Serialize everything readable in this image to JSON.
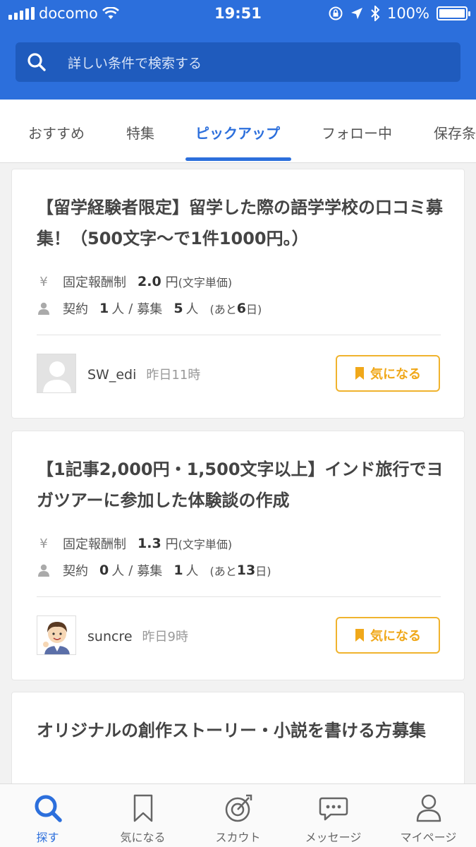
{
  "status_bar": {
    "carrier": "docomo",
    "time": "19:51",
    "battery": "100%"
  },
  "search": {
    "placeholder": "詳しい条件で検索する"
  },
  "tabs": [
    {
      "label": "おすすめ"
    },
    {
      "label": "特集"
    },
    {
      "label": "ピックアップ",
      "active": true
    },
    {
      "label": "フォロー中"
    },
    {
      "label": "保存条"
    }
  ],
  "cards": [
    {
      "title": "【留学経験者限定】留学した際の語学学校の口コミ募集！（500文字〜で1件1000円。）",
      "currency_icon": "¥",
      "pay_type": "固定報酬制",
      "price": "2.0",
      "price_unit": "円",
      "price_note": "(文字単価)",
      "contract_label": "契約",
      "contract_count": "1",
      "person_unit": "人",
      "separator": "/",
      "recruit_label": "募集",
      "recruit_count": "5",
      "remaining_prefix": "(あと",
      "remaining_days": "6",
      "remaining_suffix": "日)",
      "author": "SW_edi",
      "posted": "昨日11時",
      "fav_label": "気になる"
    },
    {
      "title": "【1記事2,000円・1,500文字以上】インド旅行でヨガツアーに参加した体験談の作成",
      "currency_icon": "¥",
      "pay_type": "固定報酬制",
      "price": "1.3",
      "price_unit": "円",
      "price_note": "(文字単価)",
      "contract_label": "契約",
      "contract_count": "0",
      "person_unit": "人",
      "separator": "/",
      "recruit_label": "募集",
      "recruit_count": "1",
      "remaining_prefix": "(あと",
      "remaining_days": "13",
      "remaining_suffix": "日)",
      "author": "suncre",
      "posted": "昨日9時",
      "fav_label": "気になる"
    },
    {
      "title": "オリジナルの創作ストーリー・小説を書ける方募集"
    }
  ],
  "bottom_nav": [
    {
      "label": "探す",
      "icon": "search-icon",
      "active": true
    },
    {
      "label": "気になる",
      "icon": "bookmark-icon"
    },
    {
      "label": "スカウト",
      "icon": "target-icon"
    },
    {
      "label": "メッセージ",
      "icon": "message-icon"
    },
    {
      "label": "マイページ",
      "icon": "user-icon"
    }
  ],
  "colors": {
    "primary": "#2c6fdc",
    "accent": "#f0b32e"
  }
}
